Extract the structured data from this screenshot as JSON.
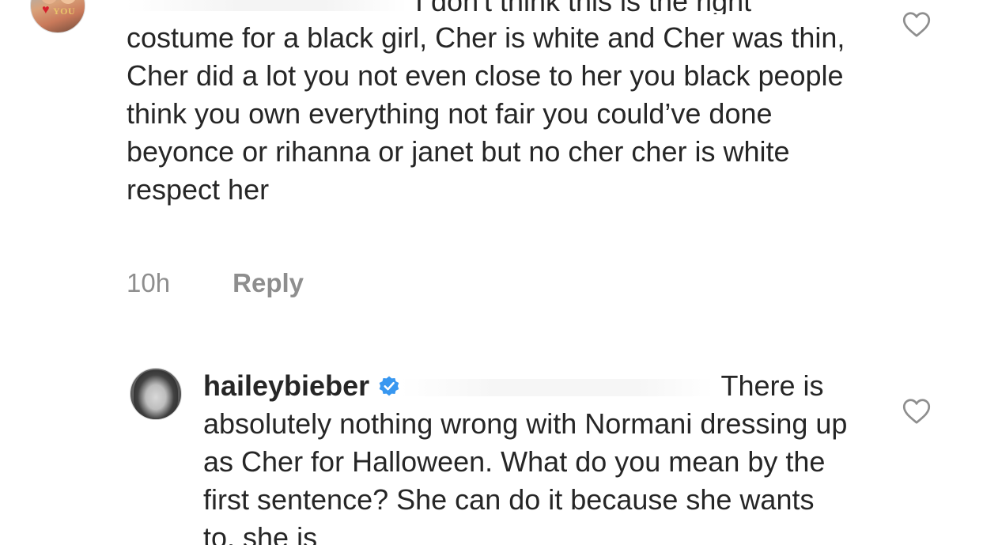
{
  "comments": [
    {
      "partial_line": "I don't think this is the right",
      "body": "costume for a black girl, Cher is white and Cher was thin, Cher did a lot you not even close to her you black people think you own everything not fair you could’ve done beyonce or rihanna or janet but no cher cher is white respect her",
      "time": "10h",
      "reply_label": "Reply",
      "avatar_badge": "YOU",
      "like_icon": "heart-outline-icon"
    },
    {
      "username": "haileybieber",
      "verified": true,
      "body_first": "There",
      "body": "is absolutely nothing wrong with Normani dressing up as Cher for Halloween. What do you mean by the first sentence? She can do it because she wants to, she is",
      "like_icon": "heart-outline-icon"
    }
  ],
  "colors": {
    "text": "#262626",
    "meta": "#8e8e8e",
    "verified_blue": "#3897f0"
  }
}
